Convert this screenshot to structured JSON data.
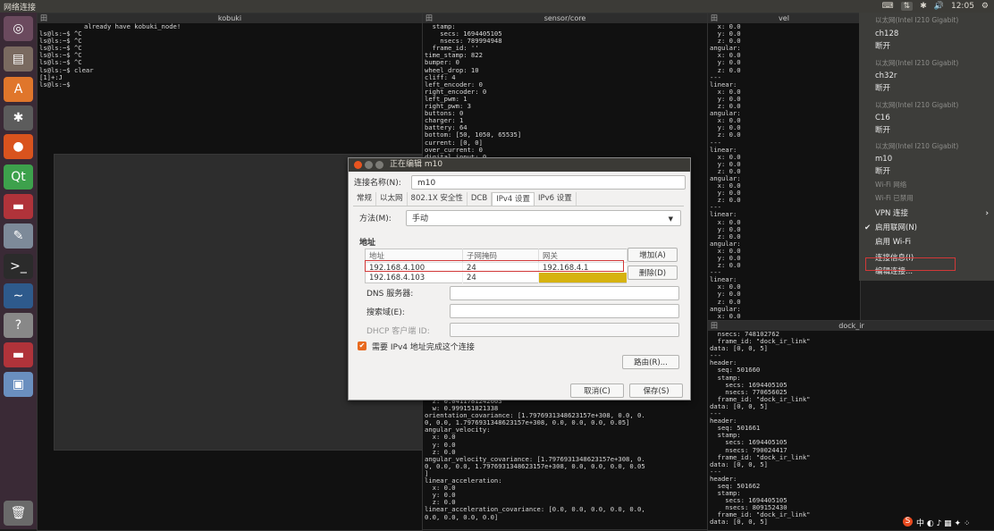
{
  "topbar": {
    "title": "网络连接",
    "time": "12:05"
  },
  "panes": {
    "kobuki": {
      "title": "kobuki",
      "message": "already have kobuki_node!",
      "lines": [
        "ls@ls:~$ ^C",
        "ls@ls:~$ ^C",
        "ls@ls:~$ ^C",
        "ls@ls:~$ ^C",
        "ls@ls:~$ ^C",
        "ls@ls:~$ clear",
        "[1]+:J",
        "ls@ls:~$"
      ]
    },
    "sensor": {
      "title": "sensor/core",
      "text_top": "  stamp:\n    secs: 1694405105\n    nsecs: 789994948\n  frame_id: ''\ntime_stamp: 822\nbumper: 0\nwheel_drop: 10\ncliff: 4\nleft_encoder: 0\nright_encoder: 0\nleft_pwm: 1\nright_pwm: 3\nbuttons: 0\ncharger: 1\nbattery: 64\nbottom: [50, 1050, 65535]\ncurrent: [0, 0]\nover_current: 0\ndigital_input: 0\nanalog_input: [9443, 9527, 39, 3]",
      "text_bottom": "  z: 0.0411781242603\n  w: 0.999151821338\norientation_covariance: [1.7976931348623157e+308, 0.0, 0.\n0, 0.0, 1.7976931348623157e+308, 0.0, 0.0, 0.0, 0.05]\nangular_velocity:\n  x: 0.0\n  y: 0.0\n  z: 0.0\nangular_velocity_covariance: [1.7976931348623157e+308, 0.\n0, 0.0, 0.0, 1.7976931348623157e+308, 0.0, 0.0, 0.0, 0.05\n]\nlinear_acceleration:\n  x: 0.0\n  y: 0.0\n  z: 0.0\nlinear_acceleration_covariance: [0.0, 0.0, 0.0, 0.0, 0.0,\n0.0, 0.0, 0.0, 0.0]"
    },
    "vel": {
      "title": "vel",
      "text": "  x: 0.0\n  y: 0.0\n  z: 0.0\nangular:\n  x: 0.0\n  y: 0.0\n  z: 0.0\n---\nlinear:\n  x: 0.0\n  y: 0.0\n  z: 0.0\nangular:\n  x: 0.0\n  y: 0.0\n  z: 0.0\n---\nlinear:\n  x: 0.0\n  y: 0.0\n  z: 0.0\nangular:\n  x: 0.0\n  y: 0.0\n  z: 0.0\n---\nlinear:\n  x: 0.0\n  y: 0.0\n  z: 0.0\nangular:\n  x: 0.0\n  y: 0.0\n  z: 0.0\n---\nlinear:\n  x: 0.0\n  y: 0.0\n  z: 0.0\nangular:\n  x: 0.0\n  y: 0.0\n  z: 0.0\n---\nlinear:\n  x: 0.0\n  y: 0.0\n  z: 0.0\nangular:\n  x: 0.0\n  y: 0.0\n  z: 0.0"
    },
    "dock": {
      "title": "dock_ir",
      "text": "  nsecs: 748102762\n  frame_id: \"dock_ir_link\"\ndata: [0, 0, 5]\n---\nheader:\n  seq: 501660\n  stamp:\n    secs: 1694405105\n    nsecs: 770656025\n  frame_id: \"dock_ir_link\"\ndata: [0, 0, 5]\n---\nheader:\n  seq: 501661\n  stamp:\n    secs: 1694405105\n    nsecs: 790024417\n  frame_id: \"dock_ir_link\"\ndata: [0, 0, 5]\n---\nheader:\n  seq: 501662\n  stamp:\n    secs: 1694405105\n    nsecs: 809152430\n  frame_id: \"dock_ir_link\"\ndata: [0, 0, 5]"
    }
  },
  "dialog": {
    "title": "正在编辑 m10",
    "conn_name_label": "连接名称(N):",
    "conn_name_value": "m10",
    "tabs": [
      "常规",
      "以太网",
      "802.1X 安全性",
      "DCB",
      "IPv4 设置",
      "IPv6 设置"
    ],
    "method_label": "方法(M):",
    "method_value": "手动",
    "address_heading": "地址",
    "columns": [
      "地址",
      "子网掩码",
      "网关"
    ],
    "rows": [
      [
        "192.168.4.100",
        "24",
        "192.168.4.1"
      ],
      [
        "192.168.4.103",
        "24",
        ""
      ]
    ],
    "add_button": "增加(A)",
    "delete_button": "删除(D)",
    "dns_label": "DNS 服务器:",
    "search_label": "搜索域(E):",
    "dhcp_label": "DHCP 客户端 ID:",
    "require_label": "需要 IPv4 地址完成这个连接",
    "route_button": "路由(R)...",
    "cancel_button": "取消(C)",
    "save_button": "保存(S)"
  },
  "netmenu": {
    "items": [
      {
        "text": "以太网(Intel I210 Gigabit)",
        "dim": true
      },
      {
        "text": "ch128",
        "dim": false
      },
      {
        "text": "断开",
        "dim": false
      },
      {
        "text": "以太网(Intel I210 Gigabit)",
        "dim": true
      },
      {
        "text": "ch32r",
        "dim": false
      },
      {
        "text": "断开",
        "dim": false
      },
      {
        "text": "以太网(Intel I210 Gigabit)",
        "dim": true
      },
      {
        "text": "C16",
        "dim": false
      },
      {
        "text": "断开",
        "dim": false
      },
      {
        "text": "以太网(Intel I210 Gigabit)",
        "dim": true
      },
      {
        "text": "m10",
        "dim": false
      },
      {
        "text": "断开",
        "dim": false
      },
      {
        "text": "Wi-Fi 网络",
        "dim": true
      },
      {
        "text": "Wi-Fi 已禁用",
        "dim": true
      },
      {
        "text": "VPN 连接",
        "dim": false
      },
      {
        "text": "启用联网(N)",
        "dim": false
      },
      {
        "text": "启用 Wi-Fi",
        "dim": false
      },
      {
        "text": "连接信息(I)",
        "dim": false
      },
      {
        "text": "编辑连接...",
        "dim": false
      }
    ]
  }
}
